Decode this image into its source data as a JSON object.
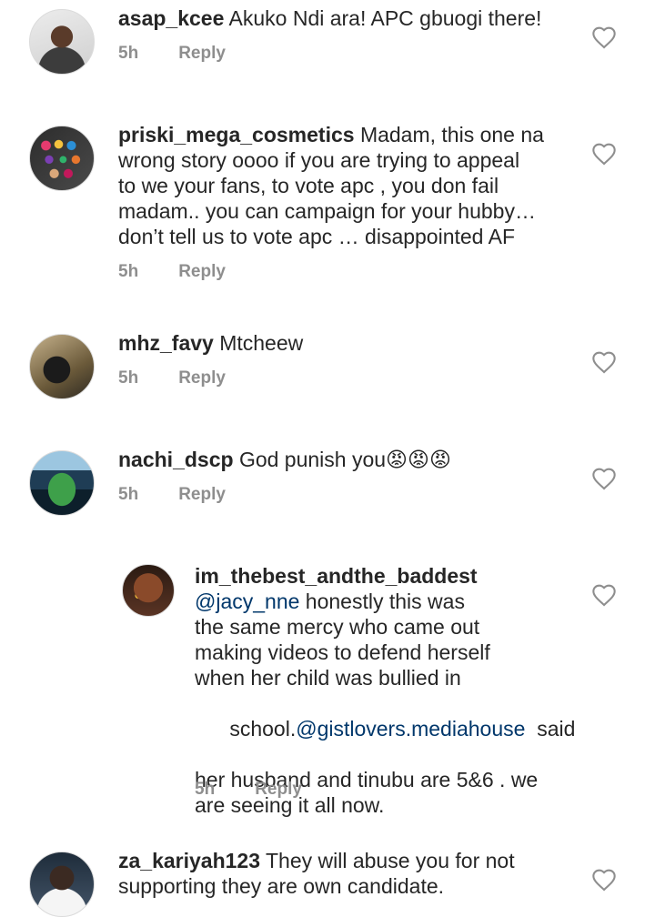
{
  "comments": [
    {
      "username": "asap_kcee",
      "lines": [
        "Akuko Ndi ara! APC gbuogi there!"
      ],
      "time": "5h",
      "reply_label": "Reply",
      "avatar_icon": "avatar-man-portrait"
    },
    {
      "username": "priski_mega_cosmetics",
      "lines": [
        "Madam, this one na",
        "wrong story oooo if you are trying to appeal",
        "to we your fans, to vote apc , you don fail",
        "madam.. you can campaign for your hubby…",
        "don’t tell us to vote apc … disappointed AF"
      ],
      "time": "5h",
      "reply_label": "Reply",
      "avatar_icon": "avatar-eyeshadow-palette"
    },
    {
      "username": "mhz_favy",
      "lines": [
        "Mtcheew"
      ],
      "time": "5h",
      "reply_label": "Reply",
      "avatar_icon": "avatar-woman-back"
    },
    {
      "username": "nachi_dscp",
      "lines": [
        "God punish you😡😡😡"
      ],
      "time": "5h",
      "reply_label": "Reply",
      "avatar_icon": "avatar-stadium"
    },
    {
      "username": "im_thebest_andthe_baddest",
      "mention1": "@jacy_nne",
      "lines_a": [
        " honestly this was",
        "the same mercy who came out",
        "making videos to defend herself",
        "when her child was bullied in"
      ],
      "line_b_prefix": "school.",
      "mention2": "@gistlovers.mediahouse",
      "line_b_suffix": "  said",
      "lines_c": [
        "her husband and tinubu are 5&6 . we",
        "are seeing it all now."
      ],
      "time": "5h",
      "reply_label": "Reply",
      "avatar_icon": "avatar-face-stickers"
    },
    {
      "username": "za_kariyah123",
      "lines": [
        "They  will abuse you for not",
        "supporting they are own candidate."
      ],
      "avatar_icon": "avatar-man-white-shirt"
    }
  ]
}
